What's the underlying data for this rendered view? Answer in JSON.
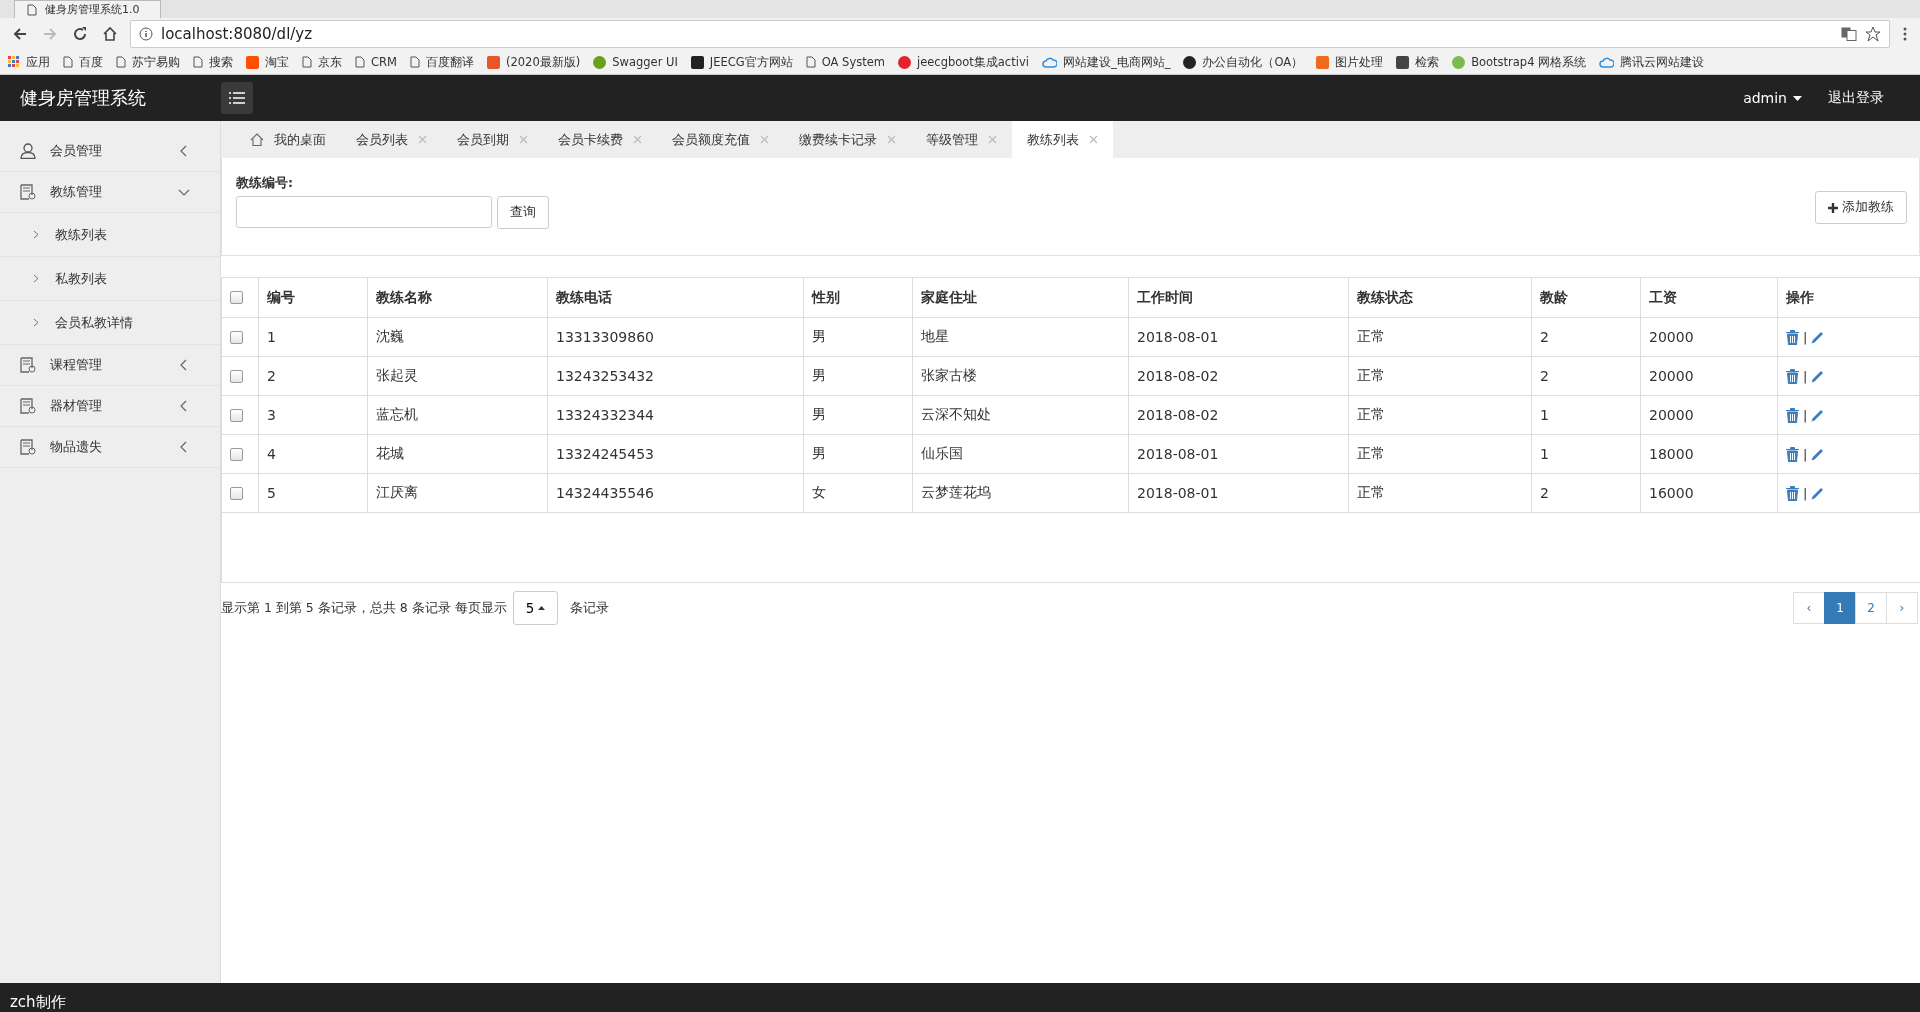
{
  "browser": {
    "tab_title": "健身房管理系统1.0",
    "address": "localhost:8080/dl/yz",
    "bookmarks": [
      {
        "label": "应用",
        "kind": "apps"
      },
      {
        "label": "百度",
        "kind": "page"
      },
      {
        "label": "苏宁易购",
        "kind": "page"
      },
      {
        "label": "搜索",
        "kind": "page"
      },
      {
        "label": "淘宝",
        "kind": "site",
        "color": "#ff5000"
      },
      {
        "label": "京东",
        "kind": "page"
      },
      {
        "label": "CRM",
        "kind": "page"
      },
      {
        "label": "百度翻译",
        "kind": "page"
      },
      {
        "label": "(2020最新版)",
        "kind": "site",
        "color": "#e8562a"
      },
      {
        "label": "Swagger UI",
        "kind": "round",
        "color": "#6a9f1c"
      },
      {
        "label": "JEECG官方网站",
        "kind": "site",
        "color": "#222222"
      },
      {
        "label": "OA System",
        "kind": "page"
      },
      {
        "label": "jeecgboot集成activi",
        "kind": "round",
        "color": "#e0242a"
      },
      {
        "label": "网站建设_电商网站_",
        "kind": "cloud",
        "color": "#2f8ee0"
      },
      {
        "label": "办公自动化（OA）",
        "kind": "round",
        "color": "#222222"
      },
      {
        "label": "图片处理",
        "kind": "site",
        "color": "#f06a1d"
      },
      {
        "label": "检索",
        "kind": "site",
        "color": "#444444"
      },
      {
        "label": "Bootstrap4 网格系统",
        "kind": "round",
        "color": "#7dbb4c"
      },
      {
        "label": "腾讯云网站建设",
        "kind": "cloud",
        "color": "#2f8ee0"
      }
    ]
  },
  "app": {
    "title": "健身房管理系统",
    "user": "admin",
    "logout": "退出登录"
  },
  "sidebar": {
    "items": [
      {
        "label": "会员管理",
        "kind": "user",
        "expanded": false
      },
      {
        "label": "教练管理",
        "kind": "module",
        "expanded": true,
        "children": [
          {
            "label": "教练列表"
          },
          {
            "label": "私教列表"
          },
          {
            "label": "会员私教详情"
          }
        ]
      },
      {
        "label": "课程管理",
        "kind": "module",
        "expanded": false
      },
      {
        "label": "器材管理",
        "kind": "module",
        "expanded": false
      },
      {
        "label": "物品遗失",
        "kind": "module",
        "expanded": false
      }
    ]
  },
  "tabs": [
    {
      "label": "我的桌面",
      "kind": "home",
      "selected": false
    },
    {
      "label": "会员列表",
      "kind": "page",
      "selected": false
    },
    {
      "label": "会员到期",
      "kind": "page",
      "selected": false
    },
    {
      "label": "会员卡续费",
      "kind": "page",
      "selected": false
    },
    {
      "label": "会员额度充值",
      "kind": "page",
      "selected": false
    },
    {
      "label": "缴费续卡记录",
      "kind": "page",
      "selected": false
    },
    {
      "label": "等级管理",
      "kind": "page",
      "selected": false
    },
    {
      "label": "教练列表",
      "kind": "page",
      "selected": true
    }
  ],
  "search": {
    "label": "教练编号:",
    "button": "查询",
    "add_button": "添加教练"
  },
  "table": {
    "header_checked": false,
    "columns": [
      "编号",
      "教练名称",
      "教练电话",
      "性别",
      "家庭住址",
      "工作时间",
      "教练状态",
      "教龄",
      "工资",
      "操作"
    ],
    "rows": [
      {
        "checked": false,
        "cells": [
          "1",
          "沈巍",
          "13313309860",
          "男",
          "地星",
          "2018-08-01",
          "正常",
          "2",
          "20000"
        ],
        "action_separator": "|"
      },
      {
        "checked": false,
        "cells": [
          "2",
          "张起灵",
          "13243253432",
          "男",
          "张家古楼",
          "2018-08-02",
          "正常",
          "2",
          "20000"
        ],
        "action_separator": "|"
      },
      {
        "checked": false,
        "cells": [
          "3",
          "蓝忘机",
          "13324332344",
          "男",
          "云深不知处",
          "2018-08-02",
          "正常",
          "1",
          "20000"
        ],
        "action_separator": "|"
      },
      {
        "checked": false,
        "cells": [
          "4",
          "花城",
          "13324245453",
          "男",
          "仙乐国",
          "2018-08-01",
          "正常",
          "1",
          "18000"
        ],
        "action_separator": "|"
      },
      {
        "checked": false,
        "cells": [
          "5",
          "江厌离",
          "14324435546",
          "女",
          "云梦莲花坞",
          "2018-08-01",
          "正常",
          "2",
          "16000"
        ],
        "action_separator": "|"
      }
    ]
  },
  "pagination": {
    "info": "显示第 1 到第 5 条记录，总共 8 条记录 每页显示",
    "page_size": "5",
    "suffix": "条记录",
    "prev": "‹",
    "next": "›",
    "pages": [
      {
        "label": "1",
        "selected": true
      },
      {
        "label": "2",
        "selected": false
      }
    ]
  },
  "footer": {
    "text": "zch制作"
  }
}
